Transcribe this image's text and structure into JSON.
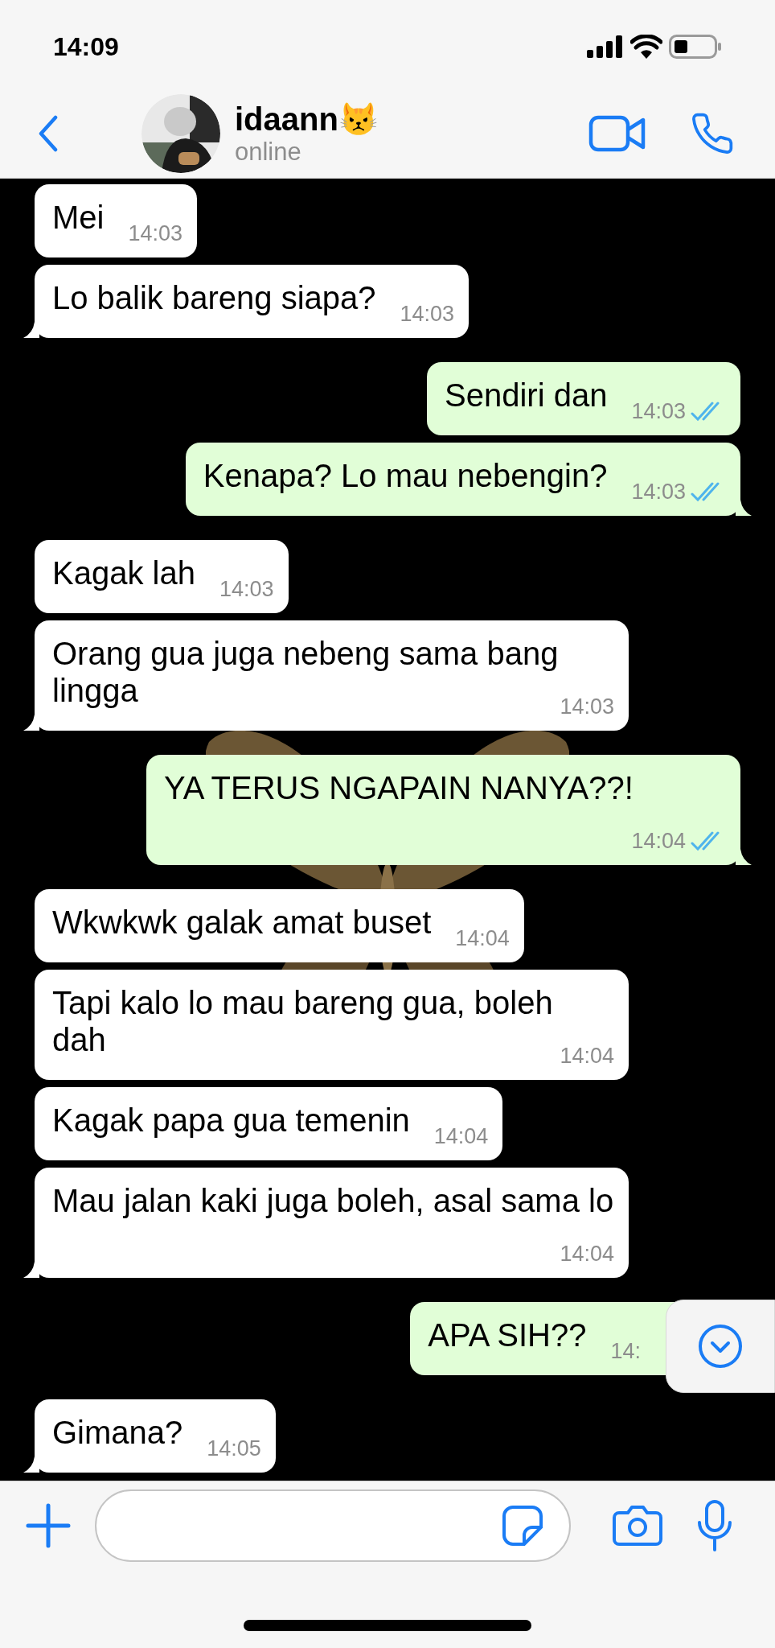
{
  "status_bar": {
    "time": "14:09"
  },
  "header": {
    "name": "idaann😾",
    "status": "online"
  },
  "messages": [
    {
      "kind": "incoming",
      "text": "Mei",
      "time": "14:03",
      "tail": false
    },
    {
      "kind": "incoming",
      "text": "Lo balik bareng siapa?",
      "time": "14:03",
      "tail": true
    },
    {
      "kind": "outgoing",
      "text": "Sendiri dan",
      "time": "14:03",
      "read": true,
      "tail": false
    },
    {
      "kind": "outgoing",
      "text": "Kenapa? Lo mau nebengin?",
      "time": "14:03",
      "read": true,
      "tail": true
    },
    {
      "kind": "incoming",
      "text": "Kagak lah",
      "time": "14:03",
      "tail": false
    },
    {
      "kind": "incoming",
      "text": "Orang gua juga nebeng sama bang lingga",
      "time": "14:03",
      "tail": true
    },
    {
      "kind": "outgoing",
      "text": "YA TERUS NGAPAIN NANYA??!",
      "time": "14:04",
      "read": true,
      "tail": true
    },
    {
      "kind": "incoming",
      "text": "Wkwkwk galak amat buset",
      "time": "14:04",
      "tail": false
    },
    {
      "kind": "incoming",
      "text": "Tapi kalo lo mau bareng gua, boleh dah",
      "time": "14:04",
      "tail": false
    },
    {
      "kind": "incoming",
      "text": "Kagak papa gua temenin",
      "time": "14:04",
      "tail": false
    },
    {
      "kind": "incoming",
      "text": "Mau jalan kaki juga boleh, asal sama lo",
      "time": "14:04",
      "tail": true
    },
    {
      "kind": "outgoing",
      "text": "APA SIH??",
      "time": "14:",
      "tail": false
    },
    {
      "kind": "incoming",
      "text": "Gimana?",
      "time": "14:05",
      "tail": true
    }
  ]
}
